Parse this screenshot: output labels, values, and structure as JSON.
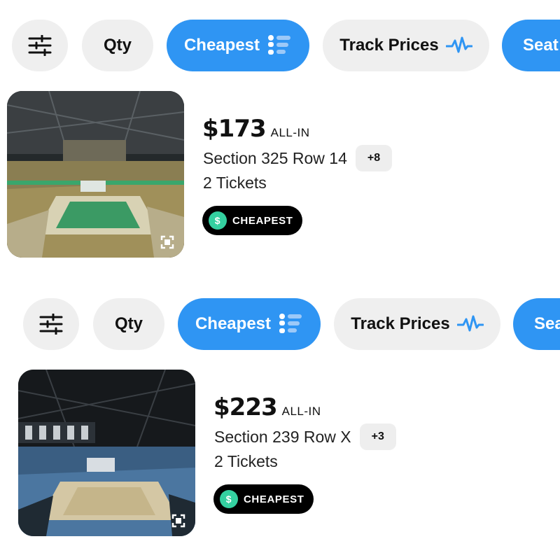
{
  "filters": {
    "qty_label": "Qty",
    "sort_label": "Cheapest",
    "track_label": "Track Prices",
    "seat_label": "Seat"
  },
  "colors": {
    "accent": "#2f95f3",
    "chip_bg": "#efefef",
    "cheap_badge_icon": "#34d0a0"
  },
  "icons": [
    "sliders-icon",
    "sort-list-icon",
    "pulse-icon",
    "expand-icon",
    "money-bag-icon"
  ],
  "listings": [
    {
      "price": "$173",
      "price_suffix": "ALL-IN",
      "section": "Section 325 Row 14",
      "more_count": "+8",
      "tickets": "2 Tickets",
      "badge": "CHEAPEST",
      "view_style": "green-court"
    },
    {
      "price": "$223",
      "price_suffix": "ALL-IN",
      "section": "Section 239 Row X",
      "more_count": "+3",
      "tickets": "2 Tickets",
      "badge": "CHEAPEST",
      "view_style": "blue-court"
    }
  ]
}
